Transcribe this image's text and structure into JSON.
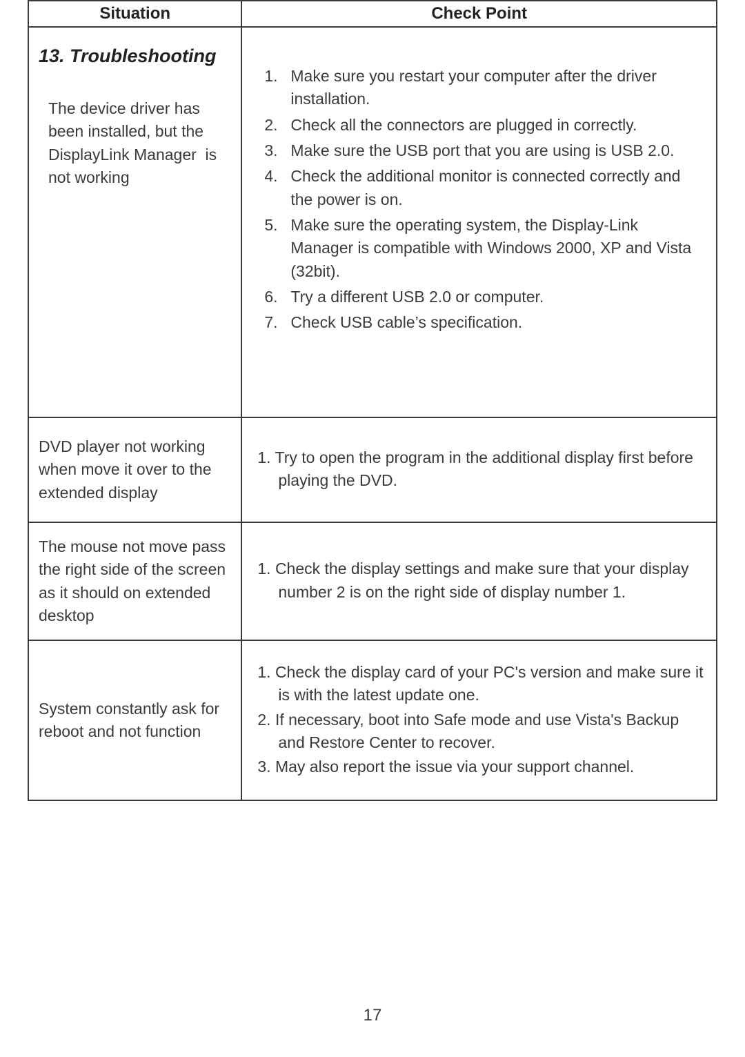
{
  "headers": {
    "situation": "Situation",
    "checkpoint": "Check Point"
  },
  "section_title": "13. Troubleshooting",
  "rows": [
    {
      "situation": "The device driver has been installed, but the DisplayLink Manager  is not working",
      "points": [
        "Make sure you restart your computer after the driver installation.",
        "Check all the connectors are plugged in correctly.",
        "Make sure the USB port that you are using is USB 2.0.",
        "Check the additional monitor is connected correctly and the power is on.",
        "Make sure the operating system, the Display-Link Manager is compatible with Windows 2000, XP and Vista (32bit).",
        "Try a different USB 2.0 or computer.",
        "Check USB cable’s specification."
      ]
    },
    {
      "situation": "DVD player not working when move it over to the extended display",
      "points": [
        "1. Try to open the program in the additional display first before playing the DVD."
      ]
    },
    {
      "situation": "The mouse not move pass the right side of the screen as it should on extended desktop",
      "points": [
        "1. Check the display settings and make sure that your display number 2 is on the right side of display number 1."
      ]
    },
    {
      "situation": "System constantly ask for reboot and not function",
      "points": [
        "1. Check the display card of your PC's version and make sure it is with the latest update one.",
        "2. If necessary, boot into Safe mode and use Vista's Backup and Restore Center to recover.",
        "3. May also report the issue via your support channel."
      ]
    }
  ],
  "page_number": "17"
}
